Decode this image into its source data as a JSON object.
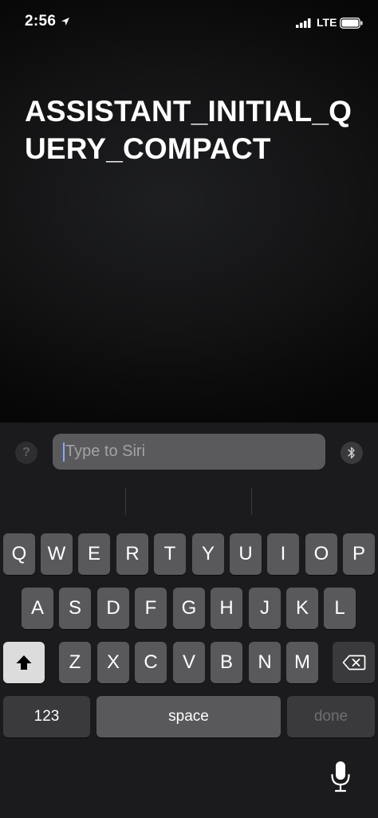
{
  "status_bar": {
    "time": "2:56",
    "network": "LTE"
  },
  "siri": {
    "prompt": "ASSISTANT_INITIAL_QUERY_COMPACT",
    "input_placeholder": "Type to Siri",
    "help_label": "?"
  },
  "keyboard": {
    "row1": [
      "Q",
      "W",
      "E",
      "R",
      "T",
      "Y",
      "U",
      "I",
      "O",
      "P"
    ],
    "row2": [
      "A",
      "S",
      "D",
      "F",
      "G",
      "H",
      "J",
      "K",
      "L"
    ],
    "row3": [
      "Z",
      "X",
      "C",
      "V",
      "B",
      "N",
      "M"
    ],
    "numbers_label": "123",
    "space_label": "space",
    "done_label": "done"
  },
  "colors": {
    "key": "#59595c",
    "key_dark": "#3a3a3c",
    "shift_active": "#dcdcdc",
    "cursor": "#8aa6ff"
  },
  "icons": {
    "location": "location-arrow-icon",
    "signal": "cellular-signal-icon",
    "battery": "battery-icon",
    "bluetooth": "bluetooth-icon",
    "shift": "shift-arrow-icon",
    "delete": "backspace-icon",
    "mic": "microphone-icon"
  }
}
